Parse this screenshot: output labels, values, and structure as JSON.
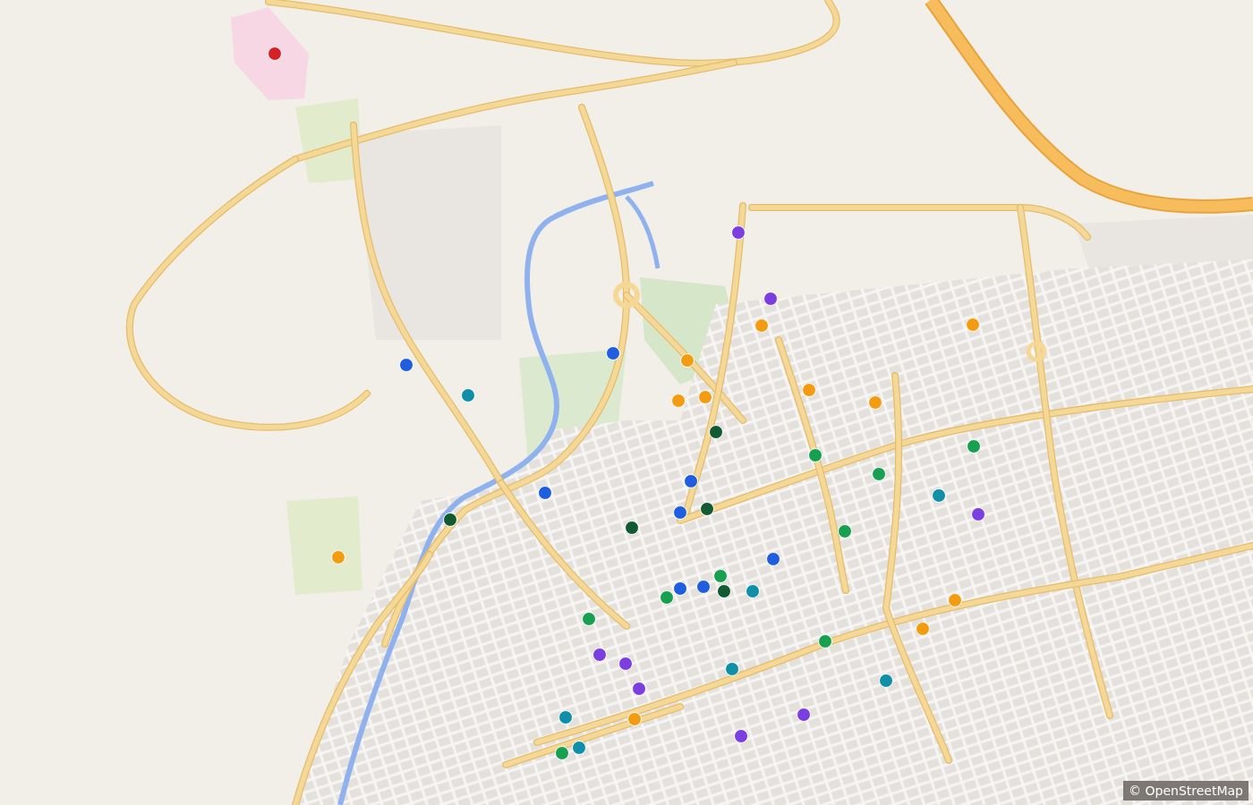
{
  "map": {
    "markers": [
      {
        "color": "#d81f26"
      },
      {
        "color": "#7b3ee0"
      },
      {
        "color": "#7b3ee0"
      },
      {
        "color": "#f39c12"
      },
      {
        "color": "#f39c12"
      },
      {
        "color": "#1f5fdf"
      },
      {
        "color": "#1f5fdf"
      },
      {
        "color": "#f39c12"
      },
      {
        "color": "#0f8fa8"
      },
      {
        "color": "#f39c12"
      },
      {
        "color": "#f39c12"
      },
      {
        "color": "#f39c12"
      },
      {
        "color": "#f39c12"
      },
      {
        "color": "#125a32"
      },
      {
        "color": "#17a050"
      },
      {
        "color": "#17a050"
      },
      {
        "color": "#17a050"
      },
      {
        "color": "#1f5fdf"
      },
      {
        "color": "#0f8fa8"
      },
      {
        "color": "#1f5fdf"
      },
      {
        "color": "#1f5fdf"
      },
      {
        "color": "#125a32"
      },
      {
        "color": "#7b3ee0"
      },
      {
        "color": "#125a32"
      },
      {
        "color": "#125a32"
      },
      {
        "color": "#17a050"
      },
      {
        "color": "#f39c12"
      },
      {
        "color": "#1f5fdf"
      },
      {
        "color": "#17a050"
      },
      {
        "color": "#17a050"
      },
      {
        "color": "#1f5fdf"
      },
      {
        "color": "#1f5fdf"
      },
      {
        "color": "#125a32"
      },
      {
        "color": "#0f8fa8"
      },
      {
        "color": "#f39c12"
      },
      {
        "color": "#17a050"
      },
      {
        "color": "#f39c12"
      },
      {
        "color": "#17a050"
      },
      {
        "color": "#7b3ee0"
      },
      {
        "color": "#7b3ee0"
      },
      {
        "color": "#0f8fa8"
      },
      {
        "color": "#0f8fa8"
      },
      {
        "color": "#7b3ee0"
      },
      {
        "color": "#7b3ee0"
      },
      {
        "color": "#0f8fa8"
      },
      {
        "color": "#f39c12"
      },
      {
        "color": "#7b3ee0"
      },
      {
        "color": "#17a050"
      },
      {
        "color": "#0f8fa8"
      }
    ]
  },
  "attribution": "© OpenStreetMap"
}
